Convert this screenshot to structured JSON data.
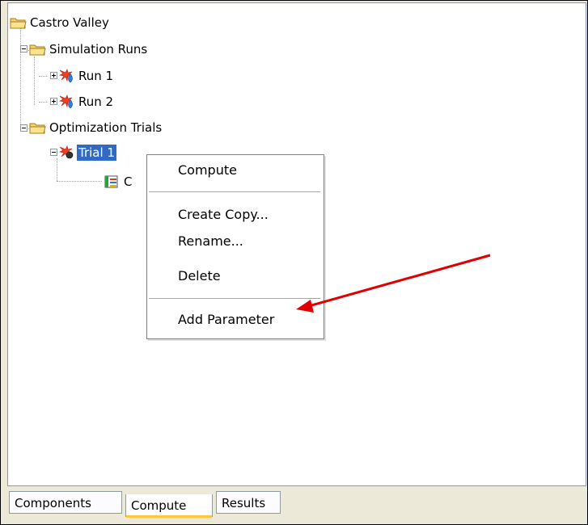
{
  "tree": {
    "root": {
      "label": "Castro Valley",
      "icon": "folder-open-icon"
    },
    "simulation_runs": {
      "label": "Simulation Runs",
      "icon": "folder-open-icon",
      "items": [
        {
          "label": "Run 1",
          "icon": "simulation-run-icon"
        },
        {
          "label": "Run 2",
          "icon": "simulation-run-icon"
        }
      ]
    },
    "optimization_trials": {
      "label": "Optimization Trials",
      "icon": "folder-open-icon",
      "trial": {
        "label": "Trial 1",
        "icon": "optimization-trial-icon",
        "selected": true
      },
      "child": {
        "label": "C",
        "icon": "parameter-table-icon"
      }
    }
  },
  "context_menu": {
    "items": [
      "Compute",
      "Create Copy...",
      "Rename...",
      "Delete",
      "Add Parameter"
    ]
  },
  "tabs": [
    "Components",
    "Compute",
    "Results"
  ],
  "active_tab": "Compute",
  "colors": {
    "selection": "#316ac5",
    "annotation_arrow": "#e00000",
    "folder": "#f3d36b",
    "tab_highlight": "#ffc83c"
  }
}
